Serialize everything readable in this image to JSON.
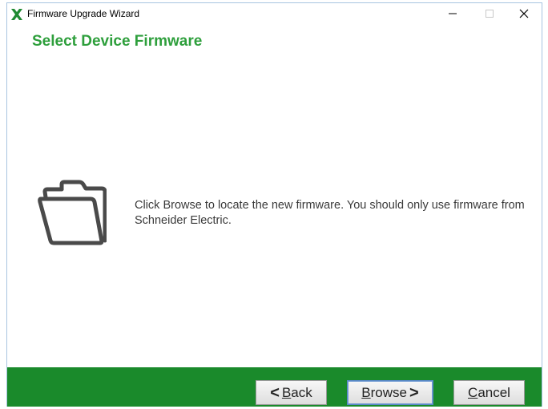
{
  "window": {
    "title": "Firmware Upgrade Wizard",
    "min_glyph": "–",
    "max_glyph": "□",
    "close_glyph": "✕",
    "icon": "schneider-x-icon"
  },
  "page": {
    "title": "Select Device Firmware",
    "message": "Click Browse to locate the new firmware. You should only use firmware from Schneider Electric.",
    "icon": "folder-open-icon"
  },
  "buttons": {
    "back": {
      "arrow": "<",
      "mnemonic": "B",
      "rest": "ack"
    },
    "browse": {
      "mnemonic": "B",
      "rest": "rowse",
      "arrow": ">"
    },
    "cancel": {
      "mnemonic": "C",
      "rest": "ancel"
    }
  },
  "colors": {
    "title_green": "#2e9f3c",
    "footer_green": "#1a8a2b"
  }
}
